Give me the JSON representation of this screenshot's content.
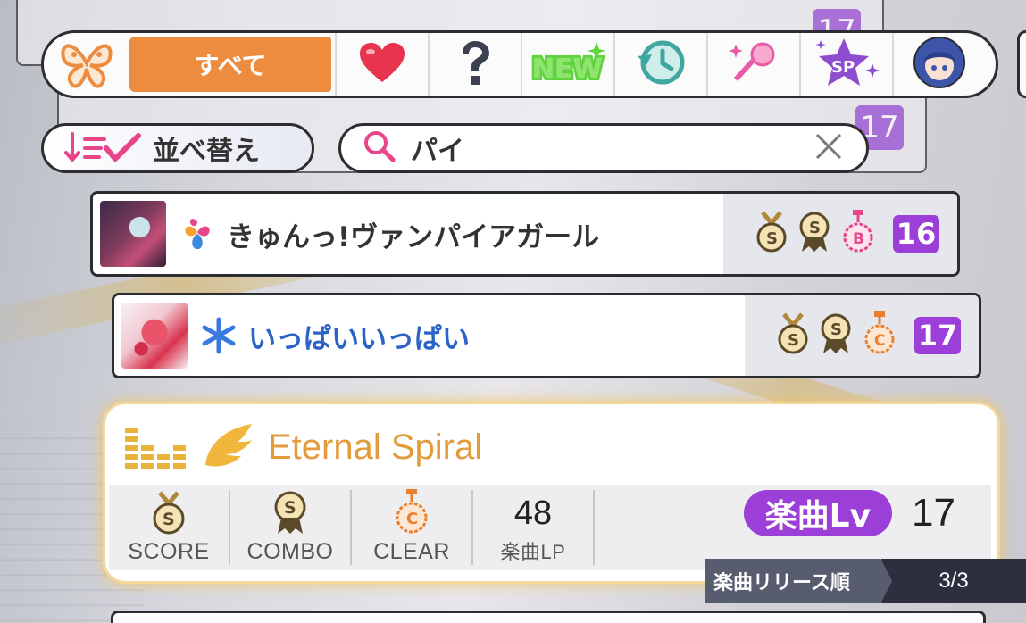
{
  "filter_bar": {
    "all_label": "すべて",
    "tabs": [
      {
        "icon": "heart-icon",
        "color": "#e8344e"
      },
      {
        "icon": "question-icon",
        "color": "#3b4150"
      },
      {
        "icon": "new-icon",
        "label": "NEW",
        "color": "#5fd43f"
      },
      {
        "icon": "history-icon",
        "color": "#3fa6a0"
      },
      {
        "icon": "microphone-icon",
        "color": "#e95aa7"
      },
      {
        "icon": "sp-star-icon",
        "label": "SP",
        "color": "#8e4ccf"
      },
      {
        "icon": "character-avatar-icon",
        "color": "#3d55a8"
      }
    ]
  },
  "ghost_cards": [
    {
      "level": "17"
    },
    {
      "level": "17"
    }
  ],
  "sort": {
    "label": "並べ替え"
  },
  "search": {
    "value": "パイ"
  },
  "songs": [
    {
      "title": "きゅんっ!ヴァンパイアガール",
      "title_color": "#333333",
      "attribute": "smile-heart-icon",
      "medals": [
        "S",
        "S",
        "B"
      ],
      "level": "16"
    },
    {
      "title": "いっぱいいっぱい",
      "title_color": "#2b64c6",
      "attribute": "cool-snowflake-icon",
      "medals": [
        "S",
        "S",
        "C"
      ],
      "level": "17"
    }
  ],
  "selected": {
    "title": "Eternal Spiral",
    "attribute": "elegant-wing-icon",
    "stats": [
      {
        "medal": "S",
        "label": "SCORE"
      },
      {
        "medal": "S",
        "label": "COMBO"
      },
      {
        "medal": "C",
        "label": "CLEAR"
      }
    ],
    "lp_value": "48",
    "lp_label": "楽曲LP",
    "level_label": "楽曲Lv",
    "level_value": "17",
    "accent": "#e39b3b"
  },
  "release": {
    "label": "楽曲リリース順",
    "count": "3/3"
  }
}
